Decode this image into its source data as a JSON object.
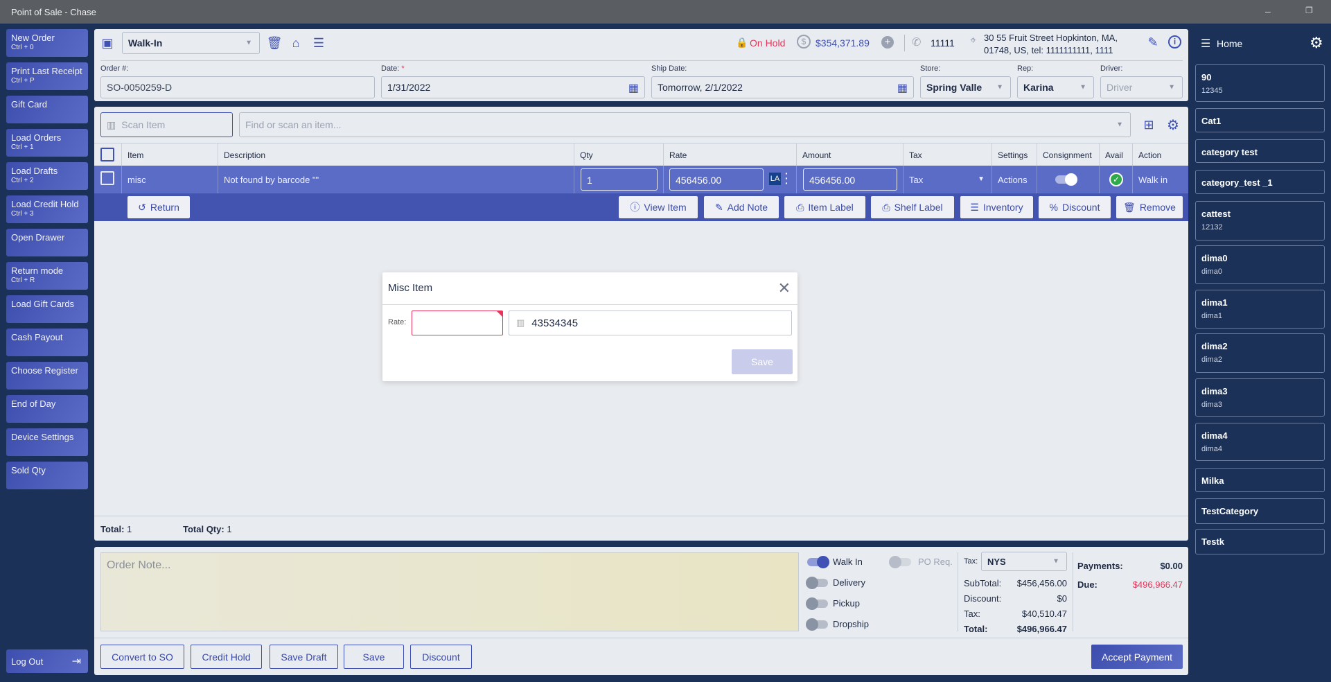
{
  "window": {
    "title": "Point of Sale - Chase",
    "minimize": "–",
    "restore": "❐"
  },
  "nav": [
    {
      "label": "New Order",
      "shortcut": "Ctrl + 0"
    },
    {
      "label": "Print Last Receipt",
      "shortcut": "Ctrl + P"
    },
    {
      "label": "Gift Card",
      "shortcut": ""
    },
    {
      "label": "Load Orders",
      "shortcut": "Ctrl + 1"
    },
    {
      "label": "Load Drafts",
      "shortcut": "Ctrl + 2"
    },
    {
      "label": "Load Credit Hold",
      "shortcut": "Ctrl + 3"
    },
    {
      "label": "Open Drawer",
      "shortcut": ""
    },
    {
      "label": "Return mode",
      "shortcut": "Ctrl + R"
    },
    {
      "label": "Load Gift Cards",
      "shortcut": ""
    },
    {
      "label": "Cash Payout",
      "shortcut": ""
    },
    {
      "label": "Choose Register",
      "shortcut": ""
    },
    {
      "label": "End of Day",
      "shortcut": ""
    },
    {
      "label": "Device Settings",
      "shortcut": ""
    },
    {
      "label": "Sold Qty",
      "shortcut": ""
    }
  ],
  "logout": "Log Out",
  "header": {
    "customer": "Walk-In",
    "status": "On Hold",
    "balance": "$354,371.89",
    "phone": "11111",
    "address_line1": "30 55 Fruit Street Hopkinton, MA,",
    "address_line2": "01748, US,  tel: 1111111111,  1111",
    "status_color": "#e8345a"
  },
  "order": {
    "order_label": "Order #:",
    "order_value": "SO-0050259-D",
    "date_label": "Date:",
    "date_required": "*",
    "date_value": "1/31/2022",
    "ship_label": "Ship Date:",
    "ship_value": "Tomorrow, 2/1/2022",
    "store_label": "Store:",
    "store_value": "Spring Valle",
    "rep_label": "Rep:",
    "rep_value": "Karina",
    "driver_label": "Driver:",
    "driver_placeholder": "Driver"
  },
  "scan": {
    "scan_placeholder": "Scan Item",
    "find_placeholder": "Find or scan an item..."
  },
  "table": {
    "columns": [
      "Item",
      "Description",
      "Qty",
      "Rate",
      "Amount",
      "Tax",
      "Settings",
      "Consignment",
      "Avail",
      "Action"
    ],
    "rows": [
      {
        "item": "misc",
        "description": "Not found by barcode \"\"",
        "qty": "1",
        "rate": "456456.00",
        "rate_badge": "LA",
        "amount": "456456.00",
        "tax": "Tax",
        "settings": "Actions",
        "consignment_on": true,
        "avail": true,
        "action": "Walk in"
      }
    ]
  },
  "row_actions": {
    "return": "Return",
    "view_item": "View Item",
    "add_note": "Add Note",
    "item_label": "Item Label",
    "shelf_label": "Shelf Label",
    "inventory": "Inventory",
    "discount": "Discount",
    "remove": "Remove"
  },
  "totals": {
    "total_label": "Total:",
    "total_value": "1",
    "qty_label": "Total Qty:",
    "qty_value": "1"
  },
  "dialog": {
    "title": "Misc Item",
    "rate_label": "Rate:",
    "rate_value": "",
    "barcode_value": "43534345",
    "save": "Save"
  },
  "bottom": {
    "note_placeholder": "Order Note...",
    "toggles": [
      {
        "label": "Walk In",
        "on": true
      },
      {
        "label": "Delivery",
        "on": false
      },
      {
        "label": "Pickup",
        "on": false
      },
      {
        "label": "Dropship",
        "on": false
      }
    ],
    "po_req": "PO Req.",
    "tax_label": "Tax:",
    "tax_value": "NYS",
    "subtotal_label": "SubTotal:",
    "subtotal": "$456,456.00",
    "discount_label": "Discount:",
    "discount": "$0",
    "tax_amt_label": "Tax:",
    "tax_amt": "$40,510.47",
    "total_label": "Total:",
    "total": "$496,966.47",
    "payments_label": "Payments:",
    "payments": "$0.00",
    "due_label": "Due:",
    "due": "$496,966.47",
    "buttons": {
      "convert": "Convert to SO",
      "credit_hold": "Credit Hold",
      "save_draft": "Save Draft",
      "save": "Save",
      "discount": "Discount",
      "accept": "Accept Payment"
    }
  },
  "right": {
    "home": "Home",
    "items": [
      {
        "name": "90",
        "sub": "12345"
      },
      {
        "name": "Cat1",
        "sub": ""
      },
      {
        "name": "category test",
        "sub": ""
      },
      {
        "name": "category_test _1",
        "sub": ""
      },
      {
        "name": "cattest",
        "sub": "12132"
      },
      {
        "name": "dima0",
        "sub": "dima0"
      },
      {
        "name": "dima1",
        "sub": "dima1"
      },
      {
        "name": "dima2",
        "sub": "dima2"
      },
      {
        "name": "dima3",
        "sub": "dima3"
      },
      {
        "name": "dima4",
        "sub": "dima4"
      },
      {
        "name": "Milka",
        "sub": ""
      },
      {
        "name": "TestCategory",
        "sub": ""
      },
      {
        "name": "Testk",
        "sub": ""
      }
    ]
  }
}
